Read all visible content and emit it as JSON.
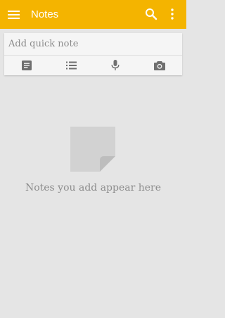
{
  "app": {
    "title": "Notes",
    "accent_color": "#f4b400"
  },
  "toolbar": {
    "menu_icon": "hamburger-menu-icon",
    "search_icon": "search-icon",
    "more_icon": "more-vert-icon"
  },
  "quick_note": {
    "placeholder": "Add quick note",
    "actions": [
      {
        "name": "text-note",
        "icon": "note-icon"
      },
      {
        "name": "list-note",
        "icon": "list-icon"
      },
      {
        "name": "voice-note",
        "icon": "microphone-icon"
      },
      {
        "name": "photo-note",
        "icon": "camera-icon"
      }
    ]
  },
  "empty_state": {
    "icon": "note-page-icon",
    "message": "Notes you add appear here"
  }
}
